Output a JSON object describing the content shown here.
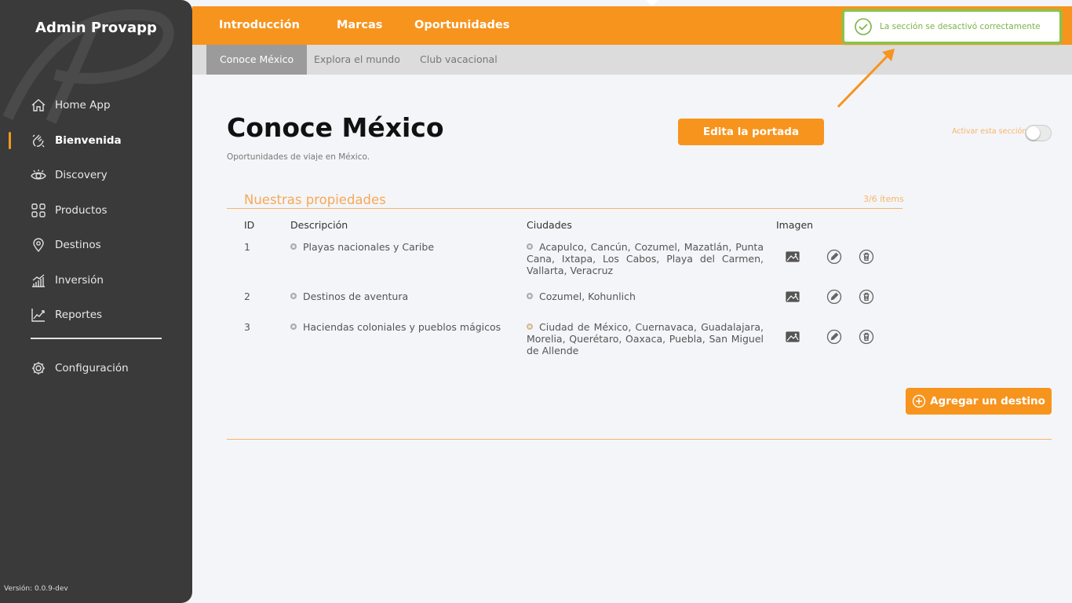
{
  "sidebar": {
    "brand": "Admin Provapp",
    "items": [
      {
        "label": "Home App",
        "icon": "home-icon"
      },
      {
        "label": "Bienvenida",
        "icon": "wave-hand-icon"
      },
      {
        "label": "Discovery",
        "icon": "eye-icon"
      },
      {
        "label": "Productos",
        "icon": "grid-icon"
      },
      {
        "label": "Destinos",
        "icon": "location-pin-icon"
      },
      {
        "label": "Inversión",
        "icon": "bar-growth-icon"
      },
      {
        "label": "Reportes",
        "icon": "line-chart-icon"
      }
    ],
    "active_item": "Bienvenida",
    "config_label": "Configuración",
    "version": "Versión: 0.0.9-dev"
  },
  "topnav": {
    "tabs": [
      "Introducción",
      "Marcas",
      "Oportunidades"
    ],
    "active_tab": "Oportunidades"
  },
  "subnav": {
    "tabs": [
      "Conoce México",
      "Explora el mundo",
      "Club vacacional"
    ],
    "active_tab": "Conoce México"
  },
  "toast": {
    "message": "La sección se desactivó correctamente",
    "status": "success",
    "color": "#7cb342"
  },
  "page": {
    "title": "Conoce México",
    "subtitle": "Oportunidades de viaje en México.",
    "edit_button": "Edita la portada",
    "toggle_label": "Activar esta sección",
    "toggle_on": false
  },
  "section": {
    "title": "Nuestras propiedades",
    "count": "3/6 ítems",
    "columns": [
      "ID",
      "Descripción",
      "Ciudades",
      "Imagen"
    ],
    "rows": [
      {
        "id": "1",
        "description": "Playas nacionales y Caribe",
        "cities": "Acapulco, Cancún, Cozumel, Mazatlán, Punta Cana, Ixtapa, Los Cabos, Playa del Carmen, Vallarta, Veracruz"
      },
      {
        "id": "2",
        "description": "Destinos de aventura",
        "cities": "Cozumel, Kohunlich"
      },
      {
        "id": "3",
        "description": "Haciendas coloniales y pueblos mágicos",
        "cities": "Ciudad de México, Cuernavaca, Guadalajara, Morelia, Querétaro, Oaxaca, Puebla, San Miguel de Allende"
      }
    ],
    "add_button": "Agregar un destino"
  },
  "colors": {
    "accent": "#f7941d",
    "sidebar_bg": "#3a3a3a",
    "success": "#8bc34a"
  }
}
